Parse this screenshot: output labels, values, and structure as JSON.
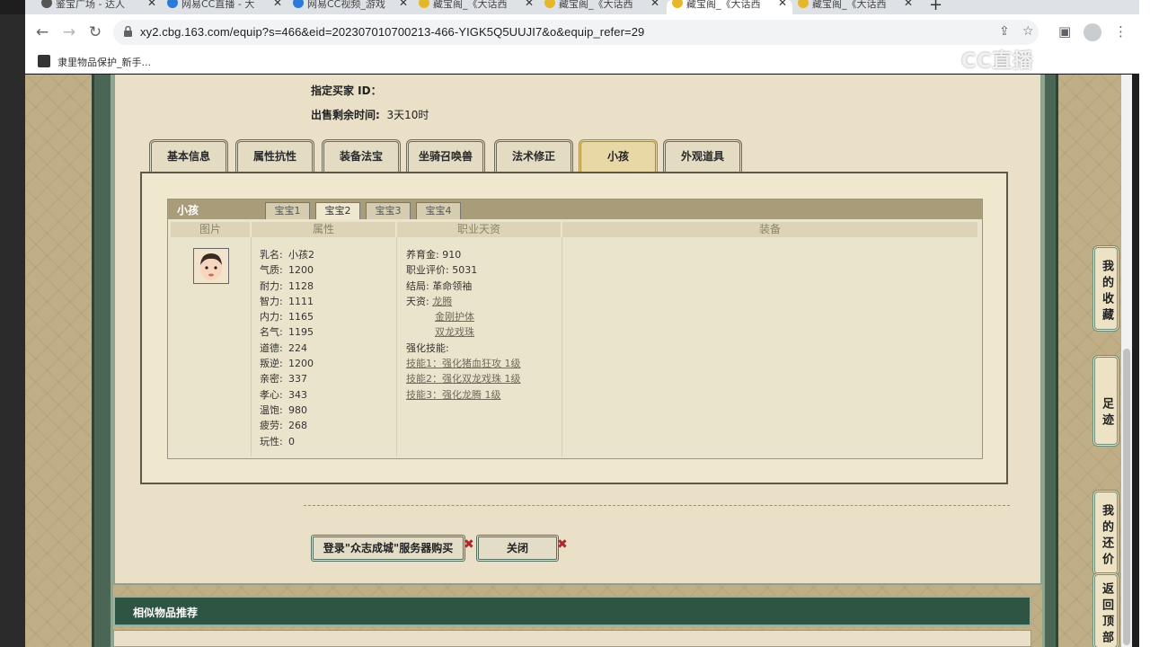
{
  "browser": {
    "tabs": [
      {
        "label": "鉴宝广场 - 达人"
      },
      {
        "label": "网易CC直播 - 大"
      },
      {
        "label": "网易CC视频_游戏"
      },
      {
        "label": "藏宝阁_《大话西"
      },
      {
        "label": "藏宝阁_《大话西"
      },
      {
        "label": "藏宝阁_《大话西"
      },
      {
        "label": "藏宝阁_《大话西"
      }
    ],
    "url": "xy2.cbg.163.com/equip?s=466&eid=202307010700213-466-YIGK5Q5UUJI7&o&equip_refer=29",
    "bookmark": "隶里物品保护_新手...",
    "watermark": "CC直播"
  },
  "listing": {
    "buyer_label": "指定买家 ID：",
    "time_label": "出售剩余时间:",
    "time_value": "3天10时"
  },
  "main_tabs": [
    "基本信息",
    "属性抗性",
    "装备法宝",
    "坐骑召唤兽",
    "法术修正",
    "小孩",
    "外观道具"
  ],
  "kid_panel": {
    "title": "小孩",
    "sub_tabs": [
      "宝宝1",
      "宝宝2",
      "宝宝3",
      "宝宝4"
    ],
    "columns": [
      "图片",
      "属性",
      "职业天资",
      "装备"
    ],
    "attributes": [
      {
        "k": "乳名:",
        "v": "小孩2"
      },
      {
        "k": "气质:",
        "v": "1200"
      },
      {
        "k": "耐力:",
        "v": "1128"
      },
      {
        "k": "智力:",
        "v": "1111"
      },
      {
        "k": "内力:",
        "v": "1165"
      },
      {
        "k": "名气:",
        "v": "1195"
      },
      {
        "k": "道德:",
        "v": "224"
      },
      {
        "k": "叛逆:",
        "v": "1200"
      },
      {
        "k": "亲密:",
        "v": "337"
      },
      {
        "k": "孝心:",
        "v": "343"
      },
      {
        "k": "温饱:",
        "v": "980"
      },
      {
        "k": "疲劳:",
        "v": "268"
      },
      {
        "k": "玩性:",
        "v": "0"
      }
    ],
    "job": {
      "fund_k": "养育金:",
      "fund_v": "910",
      "eval_k": "职业评价:",
      "eval_v": "5031",
      "ending_k": "结局:",
      "ending_v": "革命领袖",
      "talent_k": "天资:",
      "talents": [
        "龙腾",
        "金刚护体",
        "双龙戏珠"
      ],
      "skill_k": "强化技能:",
      "skills": [
        "技能1：强化猪血狂攻 1级",
        "技能2：强化双龙戏珠 1级",
        "技能3：强化龙腾 1级"
      ]
    }
  },
  "buttons": {
    "login_buy": "登录\"众志成城\"服务器购买",
    "close": "关闭"
  },
  "similar_title": "相似物品推荐",
  "sidebar": [
    "我的收藏",
    "足迹",
    "我的还价",
    "返回顶部"
  ]
}
